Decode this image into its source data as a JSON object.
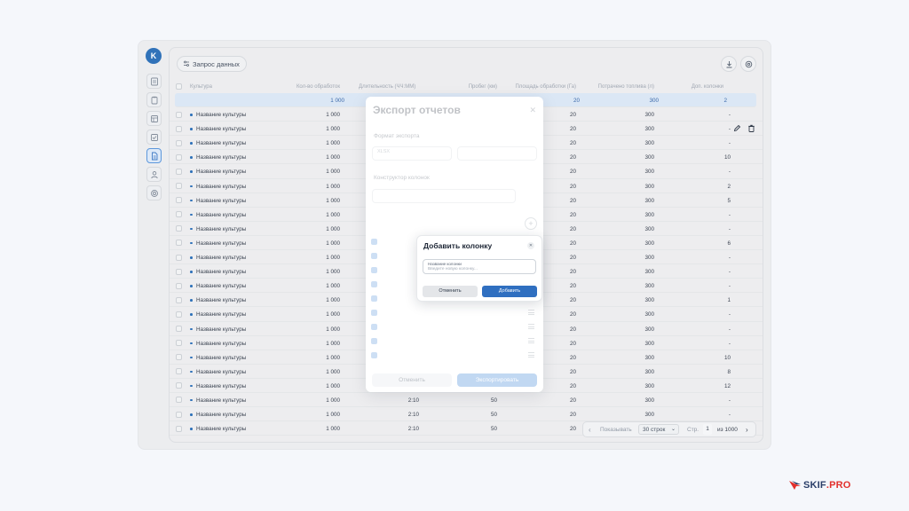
{
  "nav": {
    "avatar_letter": "K",
    "items": [
      {
        "icon": "list-icon"
      },
      {
        "icon": "clipboard-icon"
      },
      {
        "icon": "table-icon"
      },
      {
        "icon": "check-square-icon"
      },
      {
        "icon": "document-icon",
        "active": true
      },
      {
        "icon": "users-icon"
      },
      {
        "icon": "target-icon"
      }
    ]
  },
  "toolbar": {
    "request_label": "Запрос данных",
    "download_icon": "download-icon",
    "settings_icon": "settings-icon"
  },
  "table": {
    "headers": {
      "culture": "Культура",
      "treatments": "Кол-во обработок",
      "duration": "Длительность (ЧЧ:ММ)",
      "mileage": "Пробег (км)",
      "area": "Площадь обработки (Га)",
      "fuel": "Потрачено топлива (л)",
      "extra": "Доп. колонки"
    },
    "highlight_row": {
      "treatments": "1 000",
      "area": "20",
      "fuel": "300",
      "extra": "2"
    },
    "rows": [
      {
        "culture": "Название культуры",
        "treatments": "1 000",
        "duration": "",
        "mileage": "",
        "area": "20",
        "fuel": "300",
        "extra": "-"
      },
      {
        "culture": "Название культуры",
        "treatments": "1 000",
        "duration": "",
        "mileage": "",
        "area": "20",
        "fuel": "300",
        "extra": "-"
      },
      {
        "culture": "Название культуры",
        "treatments": "1 000",
        "duration": "",
        "mileage": "",
        "area": "20",
        "fuel": "300",
        "extra": "-"
      },
      {
        "culture": "Название культуры",
        "treatments": "1 000",
        "duration": "",
        "mileage": "",
        "area": "20",
        "fuel": "300",
        "extra": "10"
      },
      {
        "culture": "Название культуры",
        "treatments": "1 000",
        "duration": "",
        "mileage": "",
        "area": "20",
        "fuel": "300",
        "extra": "-"
      },
      {
        "culture": "Название культуры",
        "treatments": "1 000",
        "duration": "",
        "mileage": "",
        "area": "20",
        "fuel": "300",
        "extra": "2"
      },
      {
        "culture": "Название культуры",
        "treatments": "1 000",
        "duration": "",
        "mileage": "",
        "area": "20",
        "fuel": "300",
        "extra": "5"
      },
      {
        "culture": "Название культуры",
        "treatments": "1 000",
        "duration": "",
        "mileage": "",
        "area": "20",
        "fuel": "300",
        "extra": "-"
      },
      {
        "culture": "Название культуры",
        "treatments": "1 000",
        "duration": "",
        "mileage": "",
        "area": "20",
        "fuel": "300",
        "extra": "-"
      },
      {
        "culture": "Название культуры",
        "treatments": "1 000",
        "duration": "",
        "mileage": "",
        "area": "20",
        "fuel": "300",
        "extra": "6"
      },
      {
        "culture": "Название культуры",
        "treatments": "1 000",
        "duration": "",
        "mileage": "",
        "area": "20",
        "fuel": "300",
        "extra": "-"
      },
      {
        "culture": "Название культуры",
        "treatments": "1 000",
        "duration": "",
        "mileage": "",
        "area": "20",
        "fuel": "300",
        "extra": "-"
      },
      {
        "culture": "Название культуры",
        "treatments": "1 000",
        "duration": "",
        "mileage": "",
        "area": "20",
        "fuel": "300",
        "extra": "-"
      },
      {
        "culture": "Название культуры",
        "treatments": "1 000",
        "duration": "",
        "mileage": "",
        "area": "20",
        "fuel": "300",
        "extra": "1"
      },
      {
        "culture": "Название культуры",
        "treatments": "1 000",
        "duration": "",
        "mileage": "",
        "area": "20",
        "fuel": "300",
        "extra": "-"
      },
      {
        "culture": "Название культуры",
        "treatments": "1 000",
        "duration": "",
        "mileage": "",
        "area": "20",
        "fuel": "300",
        "extra": "-"
      },
      {
        "culture": "Название культуры",
        "treatments": "1 000",
        "duration": "",
        "mileage": "",
        "area": "20",
        "fuel": "300",
        "extra": "-"
      },
      {
        "culture": "Название культуры",
        "treatments": "1 000",
        "duration": "",
        "mileage": "",
        "area": "20",
        "fuel": "300",
        "extra": "10"
      },
      {
        "culture": "Название культуры",
        "treatments": "1 000",
        "duration": "",
        "mileage": "",
        "area": "20",
        "fuel": "300",
        "extra": "8"
      },
      {
        "culture": "Название культуры",
        "treatments": "1 000",
        "duration": "",
        "mileage": "",
        "area": "20",
        "fuel": "300",
        "extra": "12"
      },
      {
        "culture": "Название культуры",
        "treatments": "1 000",
        "duration": "2:10",
        "mileage": "50",
        "area": "20",
        "fuel": "300",
        "extra": "-"
      },
      {
        "culture": "Название культуры",
        "treatments": "1 000",
        "duration": "2:10",
        "mileage": "50",
        "area": "20",
        "fuel": "300",
        "extra": "-"
      },
      {
        "culture": "Название культуры",
        "treatments": "1 000",
        "duration": "2:10",
        "mileage": "50",
        "area": "20",
        "fuel": "",
        "extra": ""
      }
    ]
  },
  "pager": {
    "show_label": "Показывать",
    "rows_option": "30 строк",
    "page_label": "Стр.",
    "page_number": "1",
    "total_label": "из 1000"
  },
  "export_modal": {
    "title": "Экспорт отчетов",
    "format_label": "Формат экспорта",
    "format_value": "XLSX",
    "constructor_label": "Конструктор колонок",
    "cancel_label": "Отменить",
    "export_label": "Экспортировать"
  },
  "add_column_modal": {
    "title": "Добавить колонку",
    "field_label": "Название колонки",
    "field_placeholder": "Введите новую колонку...",
    "cancel_label": "Отменить",
    "add_label": "Добавить"
  },
  "brand": {
    "name_main": "SKIF",
    "name_accent": ".PRO"
  },
  "colors": {
    "accent": "#2f6fc0",
    "brand_red": "#e2302c",
    "highlight_row": "#d8e5f5"
  }
}
